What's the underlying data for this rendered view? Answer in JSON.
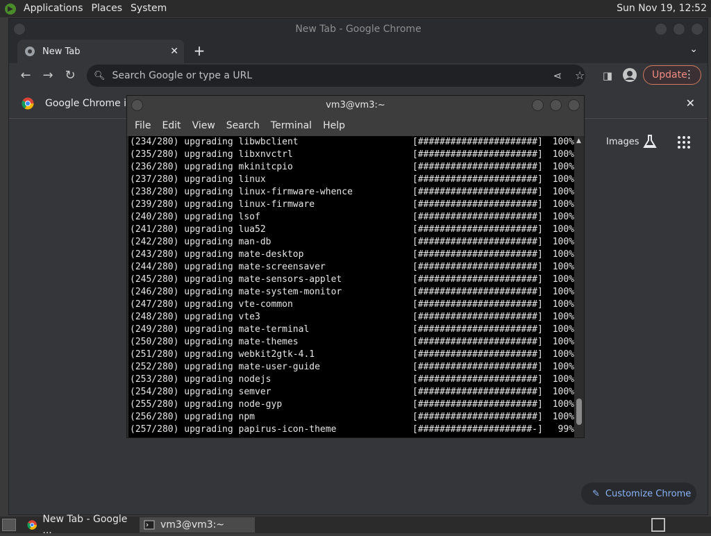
{
  "top_panel": {
    "menus": [
      "Applications",
      "Places",
      "System"
    ],
    "clock": "Sun Nov 19, 12:52"
  },
  "chrome": {
    "window_title": "New Tab - Google Chrome",
    "tab_title": "New Tab",
    "omnibox_placeholder": "Search Google or type a URL",
    "update_label": "Update",
    "infobar_text": "Google Chrome isn",
    "images_label": "Images",
    "customize_label": "Customize Chrome"
  },
  "terminal": {
    "window_title": "vm3@vm3:~",
    "menus": [
      "File",
      "Edit",
      "View",
      "Search",
      "Terminal",
      "Help"
    ],
    "lines": [
      {
        "text": "(234/280) upgrading libwbclient",
        "bar": "[######################]",
        "pct": "100%"
      },
      {
        "text": "(235/280) upgrading libxnvctrl",
        "bar": "[######################]",
        "pct": "100%"
      },
      {
        "text": "(236/280) upgrading mkinitcpio",
        "bar": "[######################]",
        "pct": "100%"
      },
      {
        "text": "(237/280) upgrading linux",
        "bar": "[######################]",
        "pct": "100%"
      },
      {
        "text": "(238/280) upgrading linux-firmware-whence",
        "bar": "[######################]",
        "pct": "100%"
      },
      {
        "text": "(239/280) upgrading linux-firmware",
        "bar": "[######################]",
        "pct": "100%"
      },
      {
        "text": "(240/280) upgrading lsof",
        "bar": "[######################]",
        "pct": "100%"
      },
      {
        "text": "(241/280) upgrading lua52",
        "bar": "[######################]",
        "pct": "100%"
      },
      {
        "text": "(242/280) upgrading man-db",
        "bar": "[######################]",
        "pct": "100%"
      },
      {
        "text": "(243/280) upgrading mate-desktop",
        "bar": "[######################]",
        "pct": "100%"
      },
      {
        "text": "(244/280) upgrading mate-screensaver",
        "bar": "[######################]",
        "pct": "100%"
      },
      {
        "text": "(245/280) upgrading mate-sensors-applet",
        "bar": "[######################]",
        "pct": "100%"
      },
      {
        "text": "(246/280) upgrading mate-system-monitor",
        "bar": "[######################]",
        "pct": "100%"
      },
      {
        "text": "(247/280) upgrading vte-common",
        "bar": "[######################]",
        "pct": "100%"
      },
      {
        "text": "(248/280) upgrading vte3",
        "bar": "[######################]",
        "pct": "100%"
      },
      {
        "text": "(249/280) upgrading mate-terminal",
        "bar": "[######################]",
        "pct": "100%"
      },
      {
        "text": "(250/280) upgrading mate-themes",
        "bar": "[######################]",
        "pct": "100%"
      },
      {
        "text": "(251/280) upgrading webkit2gtk-4.1",
        "bar": "[######################]",
        "pct": "100%"
      },
      {
        "text": "(252/280) upgrading mate-user-guide",
        "bar": "[######################]",
        "pct": "100%"
      },
      {
        "text": "(253/280) upgrading nodejs",
        "bar": "[######################]",
        "pct": "100%"
      },
      {
        "text": "(254/280) upgrading semver",
        "bar": "[######################]",
        "pct": "100%"
      },
      {
        "text": "(255/280) upgrading node-gyp",
        "bar": "[######################]",
        "pct": "100%"
      },
      {
        "text": "(256/280) upgrading npm",
        "bar": "[######################]",
        "pct": "100%"
      },
      {
        "text": "(257/280) upgrading papirus-icon-theme",
        "bar": "[#####################-]",
        "pct": "99%"
      }
    ]
  },
  "taskbar": {
    "tasks": [
      "New Tab - Google ...",
      "vm3@vm3:~"
    ]
  }
}
